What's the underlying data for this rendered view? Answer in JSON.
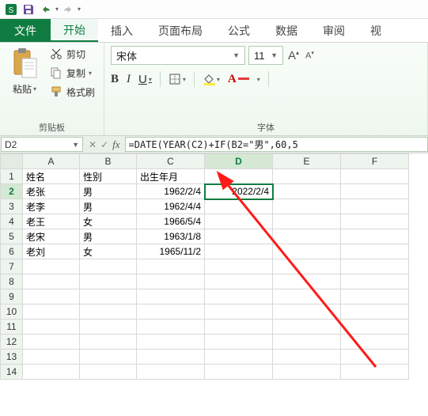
{
  "titlebar": {
    "icons": [
      "app",
      "save",
      "undo",
      "redo",
      "customize"
    ]
  },
  "tabs": {
    "file": "文件",
    "items": [
      "开始",
      "插入",
      "页面布局",
      "公式",
      "数据",
      "审阅",
      "视"
    ],
    "active_index": 0
  },
  "clipboard": {
    "paste": "粘贴",
    "cut": "剪切",
    "copy": "复制",
    "format_painter": "格式刷",
    "group_label": "剪贴板"
  },
  "font": {
    "name": "宋体",
    "size": "11",
    "group_label": "字体",
    "bold": "B",
    "italic": "I",
    "underline": "U",
    "increase": "A",
    "decrease": "A"
  },
  "fxbar": {
    "cell_ref": "D2",
    "formula": "=DATE(YEAR(C2)+IF(B2=\"男\",60,5"
  },
  "sheet": {
    "col_headers": [
      "A",
      "B",
      "C",
      "D",
      "E",
      "F"
    ],
    "selected_col_index": 3,
    "selected_row": 2,
    "row_headers": [
      "1",
      "2",
      "3",
      "4",
      "5",
      "6",
      "7",
      "8",
      "9",
      "10",
      "11",
      "12",
      "13",
      "14"
    ],
    "header_row": [
      "姓名",
      "性别",
      "出生年月",
      "",
      "",
      ""
    ],
    "data": [
      [
        "老张",
        "男",
        "1962/2/4",
        "2022/2/4",
        "",
        ""
      ],
      [
        "老李",
        "男",
        "1962/4/4",
        "",
        "",
        ""
      ],
      [
        "老王",
        "女",
        "1966/5/4",
        "",
        "",
        ""
      ],
      [
        "老宋",
        "男",
        "1963/1/8",
        "",
        "",
        ""
      ],
      [
        "老刘",
        "女",
        "1965/11/2",
        "",
        "",
        ""
      ]
    ]
  }
}
